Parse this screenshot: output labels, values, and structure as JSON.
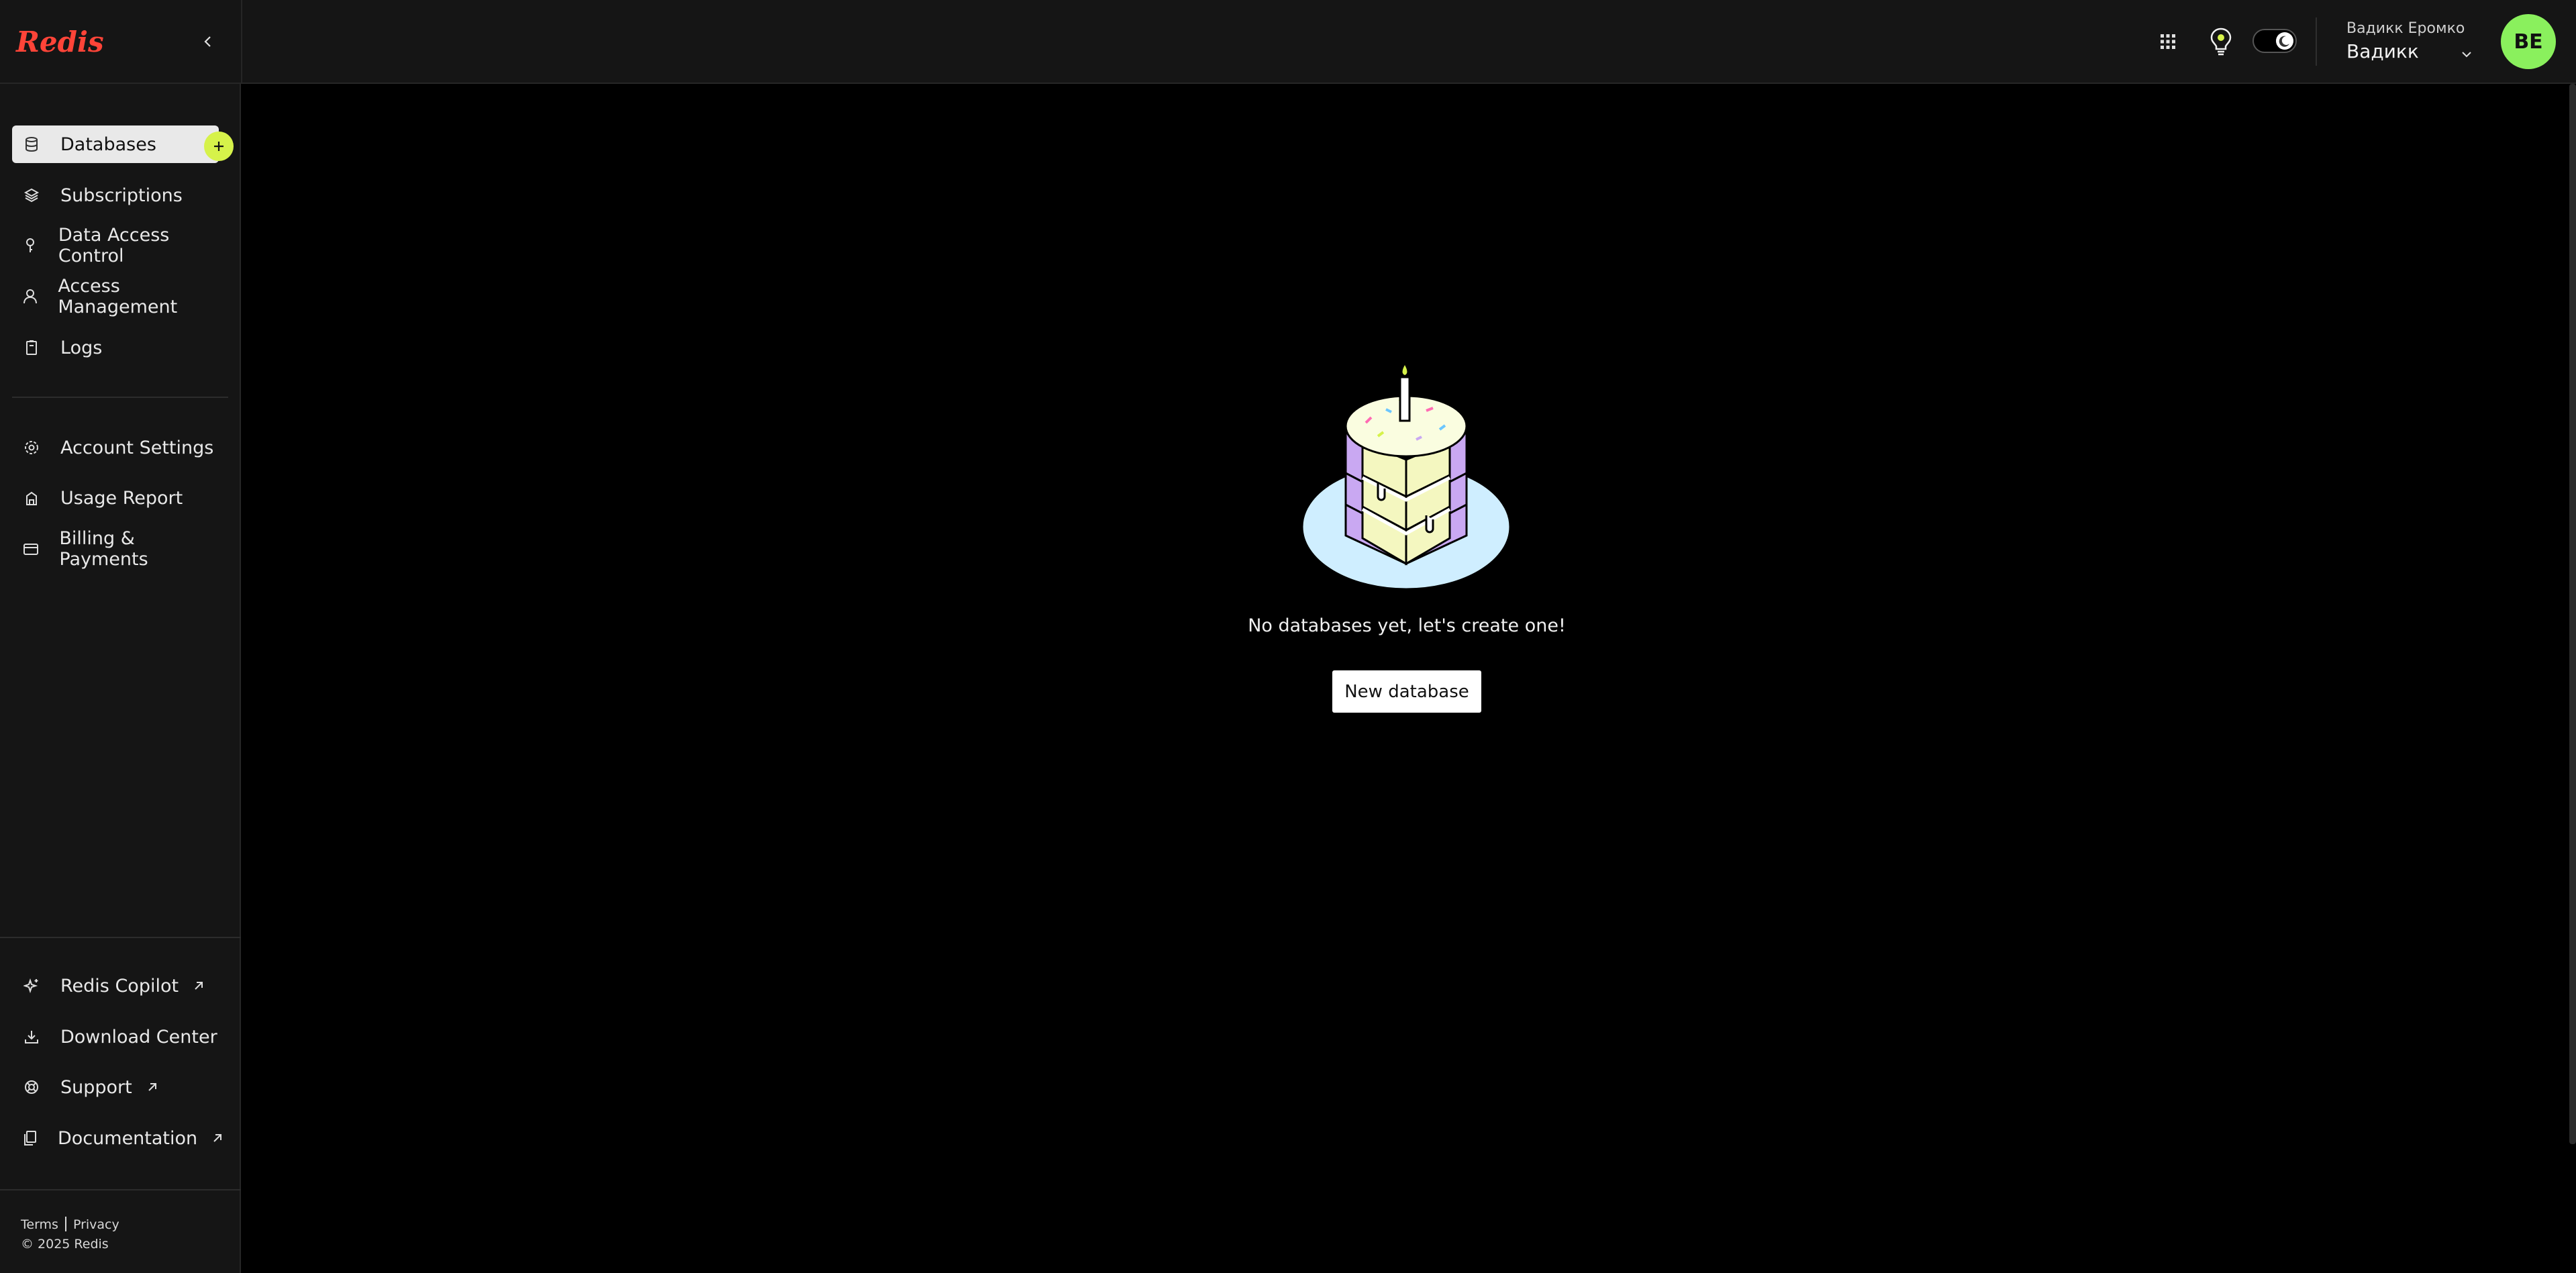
{
  "brand": {
    "logo_text": "Redis",
    "accent": "#d6f24a",
    "logo_color": "#ff4438"
  },
  "header": {
    "collapse_icon": "chevron-left-icon",
    "apps_icon": "grid-icon",
    "ideas_icon": "lightbulb-icon",
    "theme_icon": "moon-icon",
    "account": {
      "name": "Вадикк Еромко",
      "username": "Вадикк"
    },
    "avatar_initials": "ВЕ",
    "avatar_color": "#8af05d"
  },
  "sidebar": {
    "primary": [
      {
        "label": "Databases",
        "icon": "database-icon",
        "active": true
      },
      {
        "label": "Subscriptions",
        "icon": "layers-icon"
      },
      {
        "label": "Data Access Control",
        "icon": "key-icon"
      },
      {
        "label": "Access Management",
        "icon": "user-icon"
      },
      {
        "label": "Logs",
        "icon": "file-icon"
      }
    ],
    "secondary": [
      {
        "label": "Account Settings",
        "icon": "gear-icon"
      },
      {
        "label": "Usage Report",
        "icon": "report-icon"
      },
      {
        "label": "Billing & Payments",
        "icon": "credit-card-icon"
      }
    ],
    "bottom": [
      {
        "label": "Redis Copilot",
        "icon": "sparkle-icon",
        "external": true
      },
      {
        "label": "Download Center",
        "icon": "download-icon"
      },
      {
        "label": "Support",
        "icon": "lifebuoy-icon",
        "external": true
      },
      {
        "label": "Documentation",
        "icon": "docs-icon",
        "external": true
      }
    ],
    "footer": {
      "terms": "Terms",
      "privacy": "Privacy",
      "copyright": "© 2025 Redis"
    }
  },
  "main": {
    "empty_message": "No databases yet, let's create one!",
    "new_database_label": "New database",
    "illustration": "birthday-cake-icon"
  }
}
